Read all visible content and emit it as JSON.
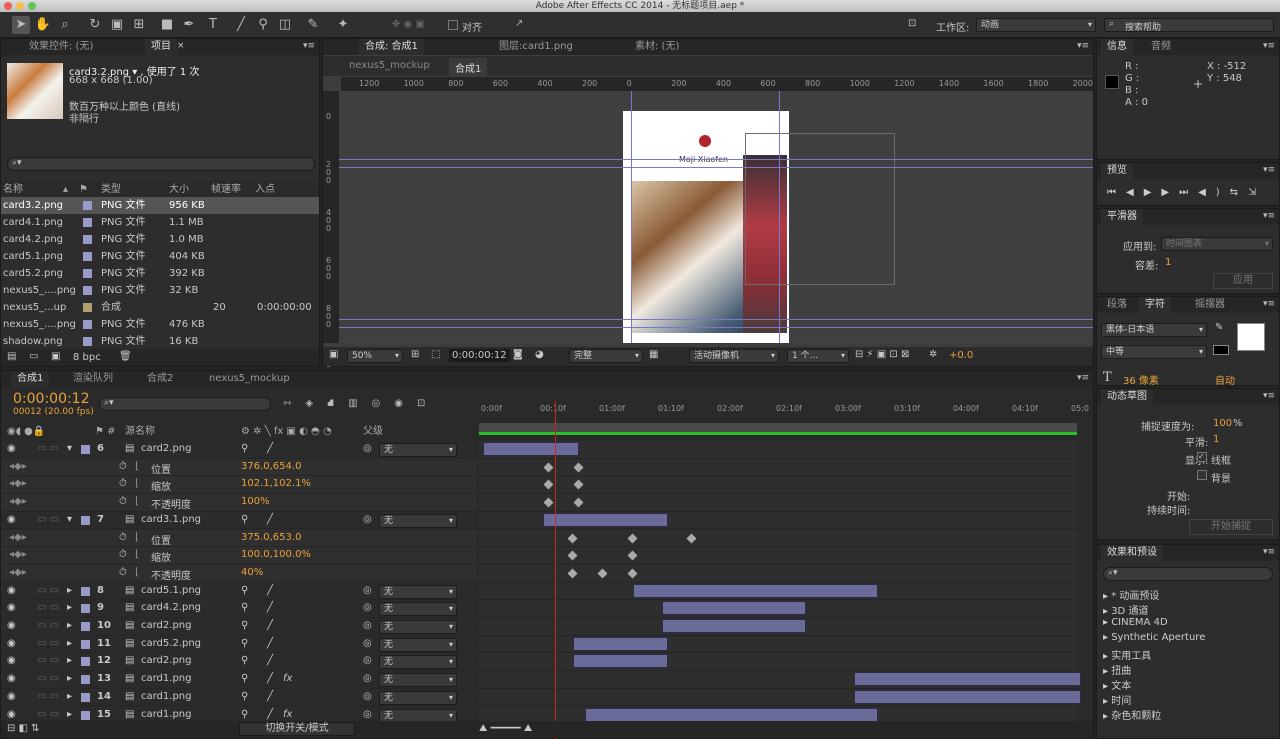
{
  "window": {
    "title": "Adobe After Effects CC 2014 - 无标题项目.aep *"
  },
  "toolbar": {
    "align_label": "对齐",
    "workspace_label": "工作区:",
    "workspace_value": "动画",
    "search_placeholder": "搜索帮助"
  },
  "left_panel": {
    "tabs": [
      "效果控件: (无)",
      "项目"
    ],
    "asset": {
      "name": "card3.2.png ▾ , 使用了 1 次",
      "size": "668 x 668 (1.00)",
      "color": "数百万种以上颜色 (直线)",
      "interlace": "非隔行"
    },
    "search_placeholder": "",
    "columns": [
      "名称",
      "类型",
      "大小",
      "帧速率",
      "入点"
    ],
    "items": [
      {
        "name": "card3.2.png",
        "type": "PNG 文件",
        "size": "956 KB",
        "fps": "",
        "in": "",
        "color": "#9a9ac8",
        "selected": true
      },
      {
        "name": "card4.1.png",
        "type": "PNG 文件",
        "size": "1.1 MB",
        "fps": "",
        "in": "",
        "color": "#9a9ac8"
      },
      {
        "name": "card4.2.png",
        "type": "PNG 文件",
        "size": "1.0 MB",
        "fps": "",
        "in": "",
        "color": "#9a9ac8"
      },
      {
        "name": "card5.1.png",
        "type": "PNG 文件",
        "size": "404 KB",
        "fps": "",
        "in": "",
        "color": "#9a9ac8"
      },
      {
        "name": "card5.2.png",
        "type": "PNG 文件",
        "size": "392 KB",
        "fps": "",
        "in": "",
        "color": "#9a9ac8"
      },
      {
        "name": "nexus5_....png",
        "type": "PNG 文件",
        "size": "32 KB",
        "fps": "",
        "in": "",
        "color": "#9a9ac8"
      },
      {
        "name": "nexus5_...up",
        "type": "合成",
        "size": "",
        "fps": "20",
        "in": "0:00:00:00",
        "color": "#b0a070"
      },
      {
        "name": "nexus5_....png",
        "type": "PNG 文件",
        "size": "476 KB",
        "fps": "",
        "in": "",
        "color": "#9a9ac8"
      },
      {
        "name": "shadow.png",
        "type": "PNG 文件",
        "size": "16 KB",
        "fps": "",
        "in": "",
        "color": "#9a9ac8"
      }
    ],
    "bpc": "8 bpc"
  },
  "comp_panel": {
    "tabs": [
      "合成: 合成1",
      "图层:card1.png",
      "素材: (无)"
    ],
    "sub_tabs": [
      "nexus5_mockup",
      "合成1"
    ],
    "ruler_h": [
      "1200",
      "1000",
      "800",
      "600",
      "400",
      "200",
      "0",
      "200",
      "400",
      "600",
      "800",
      "1000",
      "1200",
      "1400",
      "1600",
      "1800",
      "2000"
    ],
    "ruler_v": [
      "0",
      "2 0 0",
      "4 0 0",
      "6 0 0",
      "8 0 0",
      "1 0"
    ],
    "preview_caption": "Moji Xiaofen",
    "bottom": {
      "zoom": "50%",
      "time": "0:00:00:12",
      "quality": "完整",
      "camera": "活动摄像机",
      "views": "1 个...",
      "exposure": "+0.0"
    }
  },
  "info_panel": {
    "tabs": [
      "信息",
      "音频"
    ],
    "r": "R :",
    "g": "G :",
    "b": "B :",
    "a": "A : 0",
    "x": "X : -512",
    "y": "Y : 548"
  },
  "preview_panel": {
    "title": "预览"
  },
  "smoother_panel": {
    "title": "平滑器",
    "apply_label": "应用到:",
    "apply_value": "时间图表",
    "tolerance_label": "容差:",
    "tolerance_value": "1",
    "apply_button": "应用"
  },
  "char_panel": {
    "tabs": [
      "段落",
      "字符",
      "摇摆器"
    ],
    "font": "黑体-日本语",
    "style": "中等",
    "size": "36 像素",
    "leading": "自动"
  },
  "motion_panel": {
    "title": "动态草图",
    "capture_speed_label": "捕捉速度为:",
    "capture_speed_value": "100",
    "percent": "%",
    "smooth_label": "平滑:",
    "smooth_value": "1",
    "display_label": "显示:",
    "wireframe": "线框",
    "background": "背景",
    "start_label": "开始:",
    "duration_label": "持续时间:",
    "start_capture": "开始捕捉"
  },
  "effects_panel": {
    "title": "效果和预设",
    "items": [
      "* 动画预设",
      "3D 通道",
      "CINEMA 4D",
      "Synthetic Aperture",
      "实用工具",
      "扭曲",
      "文本",
      "时间",
      "杂色和颗粒"
    ]
  },
  "timeline": {
    "tabs": [
      "合成1",
      "渲染队列",
      "合成2",
      "nexus5_mockup"
    ],
    "timecode": "0:00:00:12",
    "frames": "00012 (20.00 fps)",
    "col_source": "源名称",
    "col_parent": "父级",
    "ruler": [
      "0:00f",
      "00:10f",
      "01:00f",
      "01:10f",
      "02:00f",
      "02:10f",
      "03:00f",
      "03:10f",
      "04:00f",
      "04:10f",
      "05:0"
    ],
    "playhead_frac": 0.12,
    "layers": [
      {
        "num": "6",
        "name": "card2.png",
        "parent": "无",
        "expanded": true,
        "bar": [
          0.0,
          0.16
        ]
      },
      {
        "prop": "位置",
        "value": "376.0,654.0",
        "keys": [
          0.06,
          0.11
        ]
      },
      {
        "prop": "缩放",
        "value": "102.1,102.1%",
        "keys": [
          0.06,
          0.11
        ]
      },
      {
        "prop": "不透明度",
        "value": "100%",
        "keys": [
          0.06,
          0.11
        ]
      },
      {
        "num": "7",
        "name": "card3.1.png",
        "parent": "无",
        "expanded": true,
        "bar": [
          0.1,
          0.31
        ]
      },
      {
        "prop": "位置",
        "value": "375.0,653.0",
        "keys": [
          0.1,
          0.2,
          0.3
        ]
      },
      {
        "prop": "缩放",
        "value": "100.0,100.0%",
        "keys": [
          0.1,
          0.2
        ]
      },
      {
        "prop": "不透明度",
        "value": "40%",
        "keys": [
          0.1,
          0.15,
          0.2
        ]
      },
      {
        "num": "8",
        "name": "card5.1.png",
        "parent": "无",
        "bar": [
          0.25,
          0.66
        ]
      },
      {
        "num": "9",
        "name": "card4.2.png",
        "parent": "无",
        "bar": [
          0.3,
          0.54
        ]
      },
      {
        "num": "10",
        "name": "card2.png",
        "parent": "无",
        "bar": [
          0.3,
          0.54
        ]
      },
      {
        "num": "11",
        "name": "card5.2.png",
        "parent": "无",
        "bar": [
          0.15,
          0.31
        ]
      },
      {
        "num": "12",
        "name": "card2.png",
        "parent": "无",
        "bar": [
          0.15,
          0.31
        ]
      },
      {
        "num": "13",
        "name": "card1.png",
        "parent": "无",
        "fx": true,
        "bar": [
          0.62,
          1.0
        ]
      },
      {
        "num": "14",
        "name": "card1.png",
        "parent": "无",
        "bar": [
          0.62,
          1.0
        ]
      },
      {
        "num": "15",
        "name": "card1.png",
        "parent": "无",
        "fx": true,
        "bar": [
          0.17,
          0.66
        ]
      }
    ],
    "toggle_label": "切换开关/模式"
  }
}
